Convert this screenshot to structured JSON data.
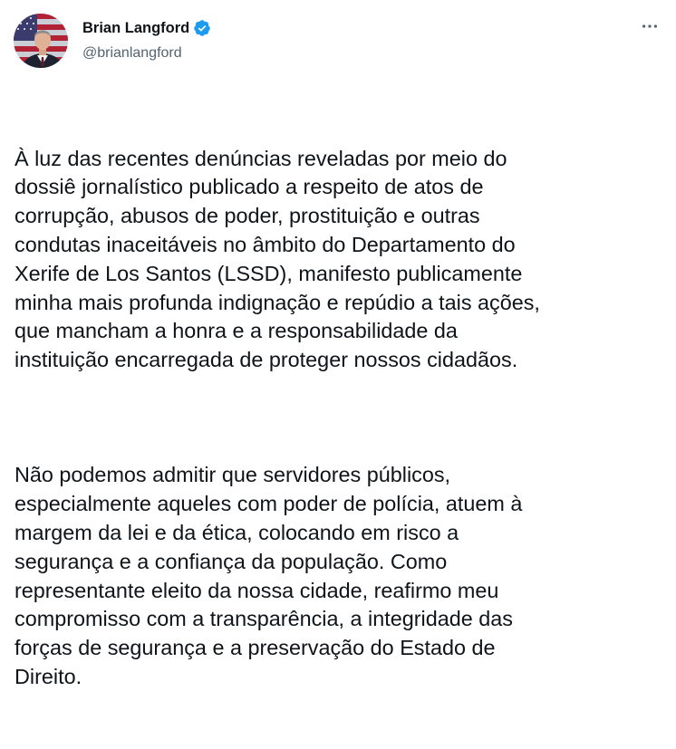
{
  "author": {
    "display_name": "Brian Langford",
    "handle": "@brianlangford",
    "verified": true,
    "verified_color": "#1d9bf0"
  },
  "icons": {
    "avatar": "profile-photo",
    "verified": "verified-badge-icon",
    "more": "more-horizontal-icon"
  },
  "tweet": {
    "paragraphs": [
      "À luz das recentes denúncias reveladas por meio do\ndossiê jornalístico publicado a respeito de atos de\ncorrupção, abusos de poder, prostituição e outras\ncondutas inaceitáveis no âmbito do Departamento do\nXerife de Los Santos (LSSD), manifesto publicamente\nminha mais profunda indignação e repúdio a tais ações,\nque mancham a honra e a responsabilidade da\ninstituição encarregada de proteger nossos cidadãos.",
      "Não podemos admitir que servidores públicos,\nespecialmente aqueles com poder de polícia, atuem à\nmargem da lei e da ética, colocando em risco a\nsegurança e a confiança da população. Como\nrepresentante eleito da nossa cidade, reafirmo meu\ncompromisso com a transparência, a integridade das\nforças de segurança e a preservação do Estado de\nDireito."
    ]
  },
  "colors": {
    "text": "#0f1419",
    "secondary": "#536471"
  }
}
